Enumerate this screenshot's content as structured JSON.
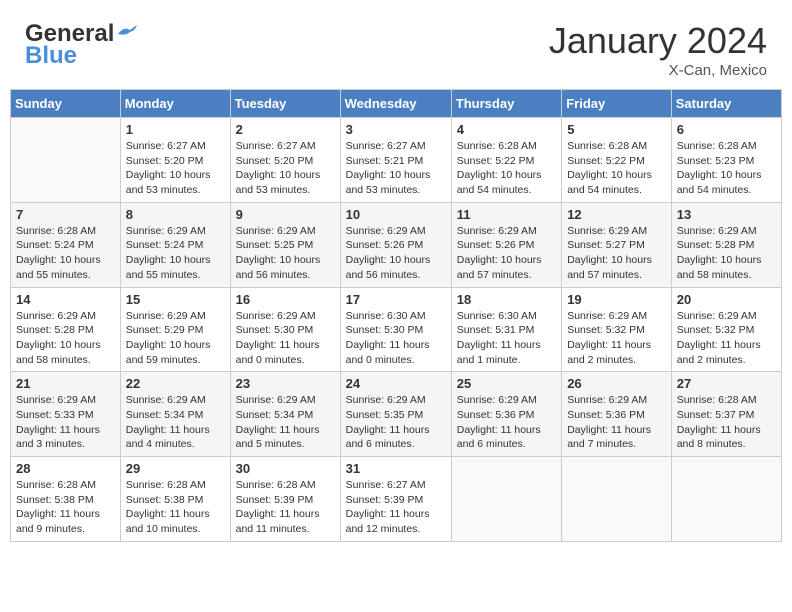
{
  "header": {
    "logo_line1": "General",
    "logo_line2": "Blue",
    "month_year": "January 2024",
    "location": "X-Can, Mexico"
  },
  "weekdays": [
    "Sunday",
    "Monday",
    "Tuesday",
    "Wednesday",
    "Thursday",
    "Friday",
    "Saturday"
  ],
  "weeks": [
    [
      {
        "day": "",
        "info": ""
      },
      {
        "day": "1",
        "info": "Sunrise: 6:27 AM\nSunset: 5:20 PM\nDaylight: 10 hours\nand 53 minutes."
      },
      {
        "day": "2",
        "info": "Sunrise: 6:27 AM\nSunset: 5:20 PM\nDaylight: 10 hours\nand 53 minutes."
      },
      {
        "day": "3",
        "info": "Sunrise: 6:27 AM\nSunset: 5:21 PM\nDaylight: 10 hours\nand 53 minutes."
      },
      {
        "day": "4",
        "info": "Sunrise: 6:28 AM\nSunset: 5:22 PM\nDaylight: 10 hours\nand 54 minutes."
      },
      {
        "day": "5",
        "info": "Sunrise: 6:28 AM\nSunset: 5:22 PM\nDaylight: 10 hours\nand 54 minutes."
      },
      {
        "day": "6",
        "info": "Sunrise: 6:28 AM\nSunset: 5:23 PM\nDaylight: 10 hours\nand 54 minutes."
      }
    ],
    [
      {
        "day": "7",
        "info": "Sunrise: 6:28 AM\nSunset: 5:24 PM\nDaylight: 10 hours\nand 55 minutes."
      },
      {
        "day": "8",
        "info": "Sunrise: 6:29 AM\nSunset: 5:24 PM\nDaylight: 10 hours\nand 55 minutes."
      },
      {
        "day": "9",
        "info": "Sunrise: 6:29 AM\nSunset: 5:25 PM\nDaylight: 10 hours\nand 56 minutes."
      },
      {
        "day": "10",
        "info": "Sunrise: 6:29 AM\nSunset: 5:26 PM\nDaylight: 10 hours\nand 56 minutes."
      },
      {
        "day": "11",
        "info": "Sunrise: 6:29 AM\nSunset: 5:26 PM\nDaylight: 10 hours\nand 57 minutes."
      },
      {
        "day": "12",
        "info": "Sunrise: 6:29 AM\nSunset: 5:27 PM\nDaylight: 10 hours\nand 57 minutes."
      },
      {
        "day": "13",
        "info": "Sunrise: 6:29 AM\nSunset: 5:28 PM\nDaylight: 10 hours\nand 58 minutes."
      }
    ],
    [
      {
        "day": "14",
        "info": "Sunrise: 6:29 AM\nSunset: 5:28 PM\nDaylight: 10 hours\nand 58 minutes."
      },
      {
        "day": "15",
        "info": "Sunrise: 6:29 AM\nSunset: 5:29 PM\nDaylight: 10 hours\nand 59 minutes."
      },
      {
        "day": "16",
        "info": "Sunrise: 6:29 AM\nSunset: 5:30 PM\nDaylight: 11 hours\nand 0 minutes."
      },
      {
        "day": "17",
        "info": "Sunrise: 6:30 AM\nSunset: 5:30 PM\nDaylight: 11 hours\nand 0 minutes."
      },
      {
        "day": "18",
        "info": "Sunrise: 6:30 AM\nSunset: 5:31 PM\nDaylight: 11 hours\nand 1 minute."
      },
      {
        "day": "19",
        "info": "Sunrise: 6:29 AM\nSunset: 5:32 PM\nDaylight: 11 hours\nand 2 minutes."
      },
      {
        "day": "20",
        "info": "Sunrise: 6:29 AM\nSunset: 5:32 PM\nDaylight: 11 hours\nand 2 minutes."
      }
    ],
    [
      {
        "day": "21",
        "info": "Sunrise: 6:29 AM\nSunset: 5:33 PM\nDaylight: 11 hours\nand 3 minutes."
      },
      {
        "day": "22",
        "info": "Sunrise: 6:29 AM\nSunset: 5:34 PM\nDaylight: 11 hours\nand 4 minutes."
      },
      {
        "day": "23",
        "info": "Sunrise: 6:29 AM\nSunset: 5:34 PM\nDaylight: 11 hours\nand 5 minutes."
      },
      {
        "day": "24",
        "info": "Sunrise: 6:29 AM\nSunset: 5:35 PM\nDaylight: 11 hours\nand 6 minutes."
      },
      {
        "day": "25",
        "info": "Sunrise: 6:29 AM\nSunset: 5:36 PM\nDaylight: 11 hours\nand 6 minutes."
      },
      {
        "day": "26",
        "info": "Sunrise: 6:29 AM\nSunset: 5:36 PM\nDaylight: 11 hours\nand 7 minutes."
      },
      {
        "day": "27",
        "info": "Sunrise: 6:28 AM\nSunset: 5:37 PM\nDaylight: 11 hours\nand 8 minutes."
      }
    ],
    [
      {
        "day": "28",
        "info": "Sunrise: 6:28 AM\nSunset: 5:38 PM\nDaylight: 11 hours\nand 9 minutes."
      },
      {
        "day": "29",
        "info": "Sunrise: 6:28 AM\nSunset: 5:38 PM\nDaylight: 11 hours\nand 10 minutes."
      },
      {
        "day": "30",
        "info": "Sunrise: 6:28 AM\nSunset: 5:39 PM\nDaylight: 11 hours\nand 11 minutes."
      },
      {
        "day": "31",
        "info": "Sunrise: 6:27 AM\nSunset: 5:39 PM\nDaylight: 11 hours\nand 12 minutes."
      },
      {
        "day": "",
        "info": ""
      },
      {
        "day": "",
        "info": ""
      },
      {
        "day": "",
        "info": ""
      }
    ]
  ]
}
